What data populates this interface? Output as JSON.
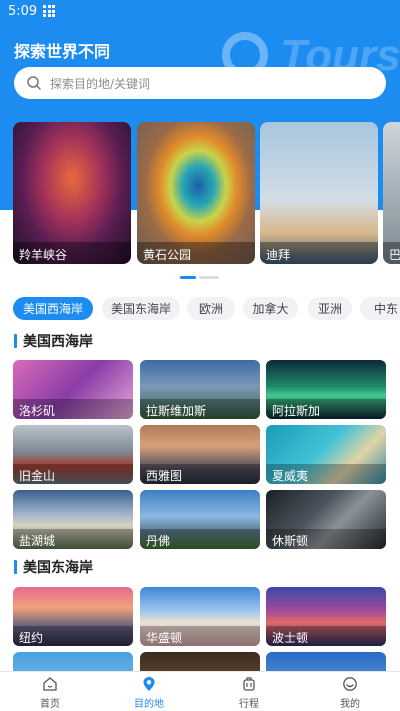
{
  "status": {
    "time": "5:09"
  },
  "header": {
    "title": "探索世界不同",
    "watermark": "Tours"
  },
  "search": {
    "placeholder": "探索目的地/关键词"
  },
  "carousel": {
    "items": [
      {
        "label": "羚羊峡谷"
      },
      {
        "label": "黄石公园"
      },
      {
        "label": "迪拜"
      },
      {
        "label": "巴"
      }
    ],
    "active_index": 0
  },
  "tabs": [
    {
      "label": "美国西海岸",
      "active": true
    },
    {
      "label": "美国东海岸"
    },
    {
      "label": "欧洲"
    },
    {
      "label": "加拿大"
    },
    {
      "label": "亚洲"
    },
    {
      "label": "中东"
    }
  ],
  "sections": [
    {
      "title": "美国西海岸",
      "items": [
        {
          "label": "洛杉矶"
        },
        {
          "label": "拉斯维加斯"
        },
        {
          "label": "阿拉斯加"
        },
        {
          "label": "旧金山"
        },
        {
          "label": "西雅图"
        },
        {
          "label": "夏威夷"
        },
        {
          "label": "盐湖城"
        },
        {
          "label": "丹佛"
        },
        {
          "label": "休斯顿"
        }
      ]
    },
    {
      "title": "美国东海岸",
      "items": [
        {
          "label": "纽约"
        },
        {
          "label": "华盛顿"
        },
        {
          "label": "波士顿"
        }
      ]
    }
  ],
  "tabbar": [
    {
      "label": "首页",
      "icon": "home-icon"
    },
    {
      "label": "目的地",
      "icon": "location-pin-icon",
      "active": true
    },
    {
      "label": "行程",
      "icon": "luggage-icon"
    },
    {
      "label": "我的",
      "icon": "smiley-icon"
    }
  ],
  "colors": {
    "accent": "#1d8cf0"
  }
}
